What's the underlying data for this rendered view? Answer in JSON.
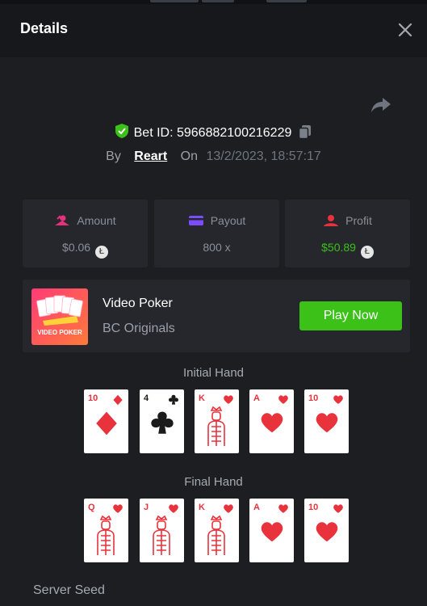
{
  "header": {
    "title": "Details"
  },
  "bet": {
    "id_label": "Bet ID:",
    "id_value": "5966882100216229",
    "by_label": "By",
    "user": "Reart",
    "on_label": "On",
    "datetime": "13/2/2023, 18:57:17"
  },
  "stats": {
    "amount": {
      "label": "Amount",
      "value": "$0.06"
    },
    "payout": {
      "label": "Payout",
      "value": "800 x"
    },
    "profit": {
      "label": "Profit",
      "value": "$50.89"
    }
  },
  "game": {
    "name": "Video Poker",
    "provider": "BC Originals",
    "thumb_label": "VIDEO POKER",
    "play_label": "Play Now"
  },
  "initial_hand": {
    "title": "Initial Hand",
    "cards": [
      {
        "rank": "10",
        "suit": "diamond",
        "color": "#e8323c"
      },
      {
        "rank": "4",
        "suit": "club",
        "color": "#1b1b1b"
      },
      {
        "rank": "K",
        "suit": "heart",
        "color": "#e8323c"
      },
      {
        "rank": "A",
        "suit": "heart",
        "color": "#e8323c"
      },
      {
        "rank": "10",
        "suit": "heart",
        "color": "#e8323c"
      }
    ]
  },
  "final_hand": {
    "title": "Final Hand",
    "cards": [
      {
        "rank": "Q",
        "suit": "heart",
        "color": "#e8323c"
      },
      {
        "rank": "J",
        "suit": "heart",
        "color": "#e8323c"
      },
      {
        "rank": "K",
        "suit": "heart",
        "color": "#e8323c"
      },
      {
        "rank": "A",
        "suit": "heart",
        "color": "#e8323c"
      },
      {
        "rank": "10",
        "suit": "heart",
        "color": "#e8323c"
      }
    ]
  },
  "server_seed": {
    "label": "Server Seed"
  },
  "colors": {
    "accent_green": "#3bc117",
    "profit_green": "#3bc117",
    "card_red": "#e8323c",
    "panel": "#25272c",
    "background": "#1c1e22"
  },
  "icons": {
    "close": "close-icon",
    "share": "share-icon",
    "shield": "shield-check-icon",
    "copy": "copy-icon",
    "amount": "amount-icon",
    "payout": "card-icon",
    "profit": "profit-icon",
    "coin": "coin-icon"
  }
}
